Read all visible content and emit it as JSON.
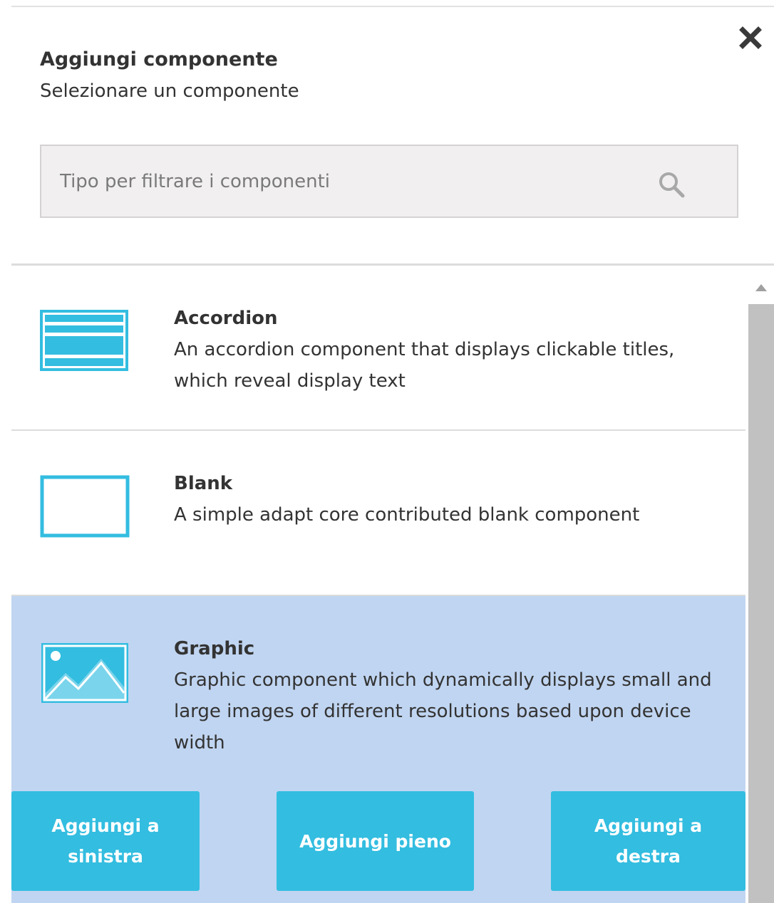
{
  "dialog": {
    "title": "Aggiungi componente",
    "subtitle": "Selezionare un componente",
    "close_icon": "close-icon"
  },
  "search": {
    "placeholder": "Tipo per filtrare i componenti",
    "value": "",
    "icon": "search-icon"
  },
  "components": [
    {
      "name": "Accordion",
      "description": "An accordion component that displays clickable titles, which reveal display text",
      "icon": "accordion-icon"
    },
    {
      "name": "Blank",
      "description": "A simple adapt core contributed blank component",
      "icon": "blank-icon"
    },
    {
      "name": "Graphic",
      "description": "Graphic component which dynamically displays small and large images of different resolutions based upon device width",
      "icon": "image-icon",
      "selected": true
    }
  ],
  "actions": {
    "add_left": "Aggiungi a sinistra",
    "add_full": "Aggiungi pieno",
    "add_right": "Aggiungi a destra"
  },
  "colors": {
    "accent": "#33bde0",
    "selected_bg": "#c0d5f1",
    "search_bg": "#f1efef",
    "text": "#333333"
  }
}
